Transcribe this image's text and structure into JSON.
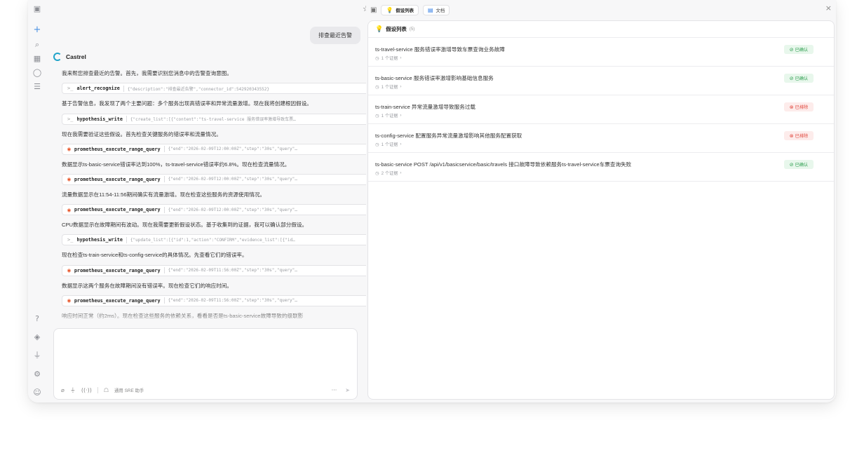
{
  "rail": {
    "top_icons": [
      "sidebar-toggle-icon"
    ],
    "icons": [
      {
        "name": "new-chat-icon",
        "glyph": "+"
      },
      {
        "name": "search-icon",
        "glyph": "⌕"
      },
      {
        "name": "apps-icon",
        "glyph": "▦"
      },
      {
        "name": "chat-bubble-icon",
        "glyph": "◯"
      },
      {
        "name": "list-icon",
        "glyph": "☰"
      }
    ],
    "bottom_icons": [
      {
        "name": "help-icon",
        "glyph": "?"
      },
      {
        "name": "puzzle-icon",
        "glyph": "◈"
      },
      {
        "name": "plug-icon",
        "glyph": "⏚"
      },
      {
        "name": "settings-icon",
        "glyph": "⚙"
      },
      {
        "name": "user-icon",
        "glyph": "☺"
      }
    ]
  },
  "chat": {
    "user_message": "排查最近告警",
    "bot_name": "Castrel",
    "messages": [
      {
        "type": "text",
        "text": "我来帮您排查最近的告警。首先，我需要识别您消息中的告警查询意图。"
      },
      {
        "type": "tool",
        "icon": "terminal-icon",
        "name": "alert_recognize",
        "args": "{\"description\":\"排查最近告警\",\"connector_id\":542920343552}"
      },
      {
        "type": "text",
        "text": "基于告警信息，我发现了两个主要问题：多个服务出现高错误率和异常流量激增。现在我将创建根因假设。"
      },
      {
        "type": "tool",
        "icon": "terminal-icon",
        "name": "hypothesis_write",
        "args": "{\"create_list\":[{\"content\":\"ts-travel-service 服务错误率激增导致车票…"
      },
      {
        "type": "text",
        "text": "现在我需要验证这些假设。首先检查关键服务的错误率和流量情况。"
      },
      {
        "type": "tool",
        "icon": "prometheus-icon",
        "name": "prometheus_execute_range_query",
        "args": "{\"end\":\"2026-02-09T12:00:00Z\",\"step\":\"30s\",\"query\"…"
      },
      {
        "type": "text",
        "text": "数据显示ts-basic-service错误率达到100%，ts-travel-service错误率约6.8%。现在检查流量情况。"
      },
      {
        "type": "tool",
        "icon": "prometheus-icon",
        "name": "prometheus_execute_range_query",
        "args": "{\"end\":\"2026-02-09T12:00:00Z\",\"step\":\"30s\",\"query\"…"
      },
      {
        "type": "text",
        "text": "流量数据显示在11:54-11:56期间确实有流量激增。现在检查这些服务的资源使用情况。"
      },
      {
        "type": "tool",
        "icon": "prometheus-icon",
        "name": "prometheus_execute_range_query",
        "args": "{\"end\":\"2026-02-09T12:00:00Z\",\"step\":\"30s\",\"query\"…"
      },
      {
        "type": "text",
        "text": "CPU数据显示在故障期间有波动。现在我需要更新假设状态。基于收集到的证据，我可以确认部分假设。"
      },
      {
        "type": "tool",
        "icon": "terminal-icon",
        "name": "hypothesis_write",
        "args": "{\"update_list\":[{\"id\":1,\"action\":\"CONFIRM\",\"evidence_list\":[{\"id…"
      },
      {
        "type": "text",
        "text": "现在检查ts-train-service和ts-config-service的具体情况。先查看它们的错误率。"
      },
      {
        "type": "tool",
        "icon": "prometheus-icon",
        "name": "prometheus_execute_range_query",
        "args": "{\"end\":\"2026-02-09T11:56:00Z\",\"step\":\"30s\",\"query\"…"
      },
      {
        "type": "text",
        "text": "数据显示这两个服务在故障期间没有错误率。现在检查它们的响应时间。"
      },
      {
        "type": "tool",
        "icon": "prometheus-icon",
        "name": "prometheus_execute_range_query",
        "args": "{\"end\":\"2026-02-09T11:56:00Z\",\"step\":\"30s\",\"query\"…"
      },
      {
        "type": "text",
        "text": "响应时间正常（约2ms）。现在检查这些服务的依赖关系，看看是否是ts-basic-service故障导致的级联影"
      }
    ],
    "composer": {
      "placeholder": "",
      "agent_label": "通用 SRE 助手",
      "more": "···",
      "send": "➤"
    }
  },
  "panel": {
    "tabs": [
      {
        "label": "假设列表",
        "icon": "bulb-icon",
        "active": true
      },
      {
        "label": "文档",
        "icon": "document-icon",
        "active": false
      }
    ],
    "close": "×",
    "title": "假设列表",
    "count": "(5)",
    "hypotheses": [
      {
        "title": "ts-travel-service 服务错误率激增导致车票查询业务故障",
        "evidence": "1 个证据",
        "status": "已确认",
        "state": "ok"
      },
      {
        "title": "ts-basic-service 服务错误率激增影响基础信息服务",
        "evidence": "1 个证据",
        "status": "已确认",
        "state": "ok"
      },
      {
        "title": "ts-train-service 异常流量激增导致服务过载",
        "evidence": "1 个证据",
        "status": "已排除",
        "state": "no"
      },
      {
        "title": "ts-config-service 配置服务异常流量激增影响其他服务配置获取",
        "evidence": "1 个证据",
        "status": "已排除",
        "state": "no"
      },
      {
        "title": "ts-basic-service POST /api/v1/basicservice/basic/travels 接口故障导致依赖服务ts-travel-service车票查询失败",
        "evidence": "2 个证据",
        "status": "已确认",
        "state": "ok"
      }
    ]
  }
}
